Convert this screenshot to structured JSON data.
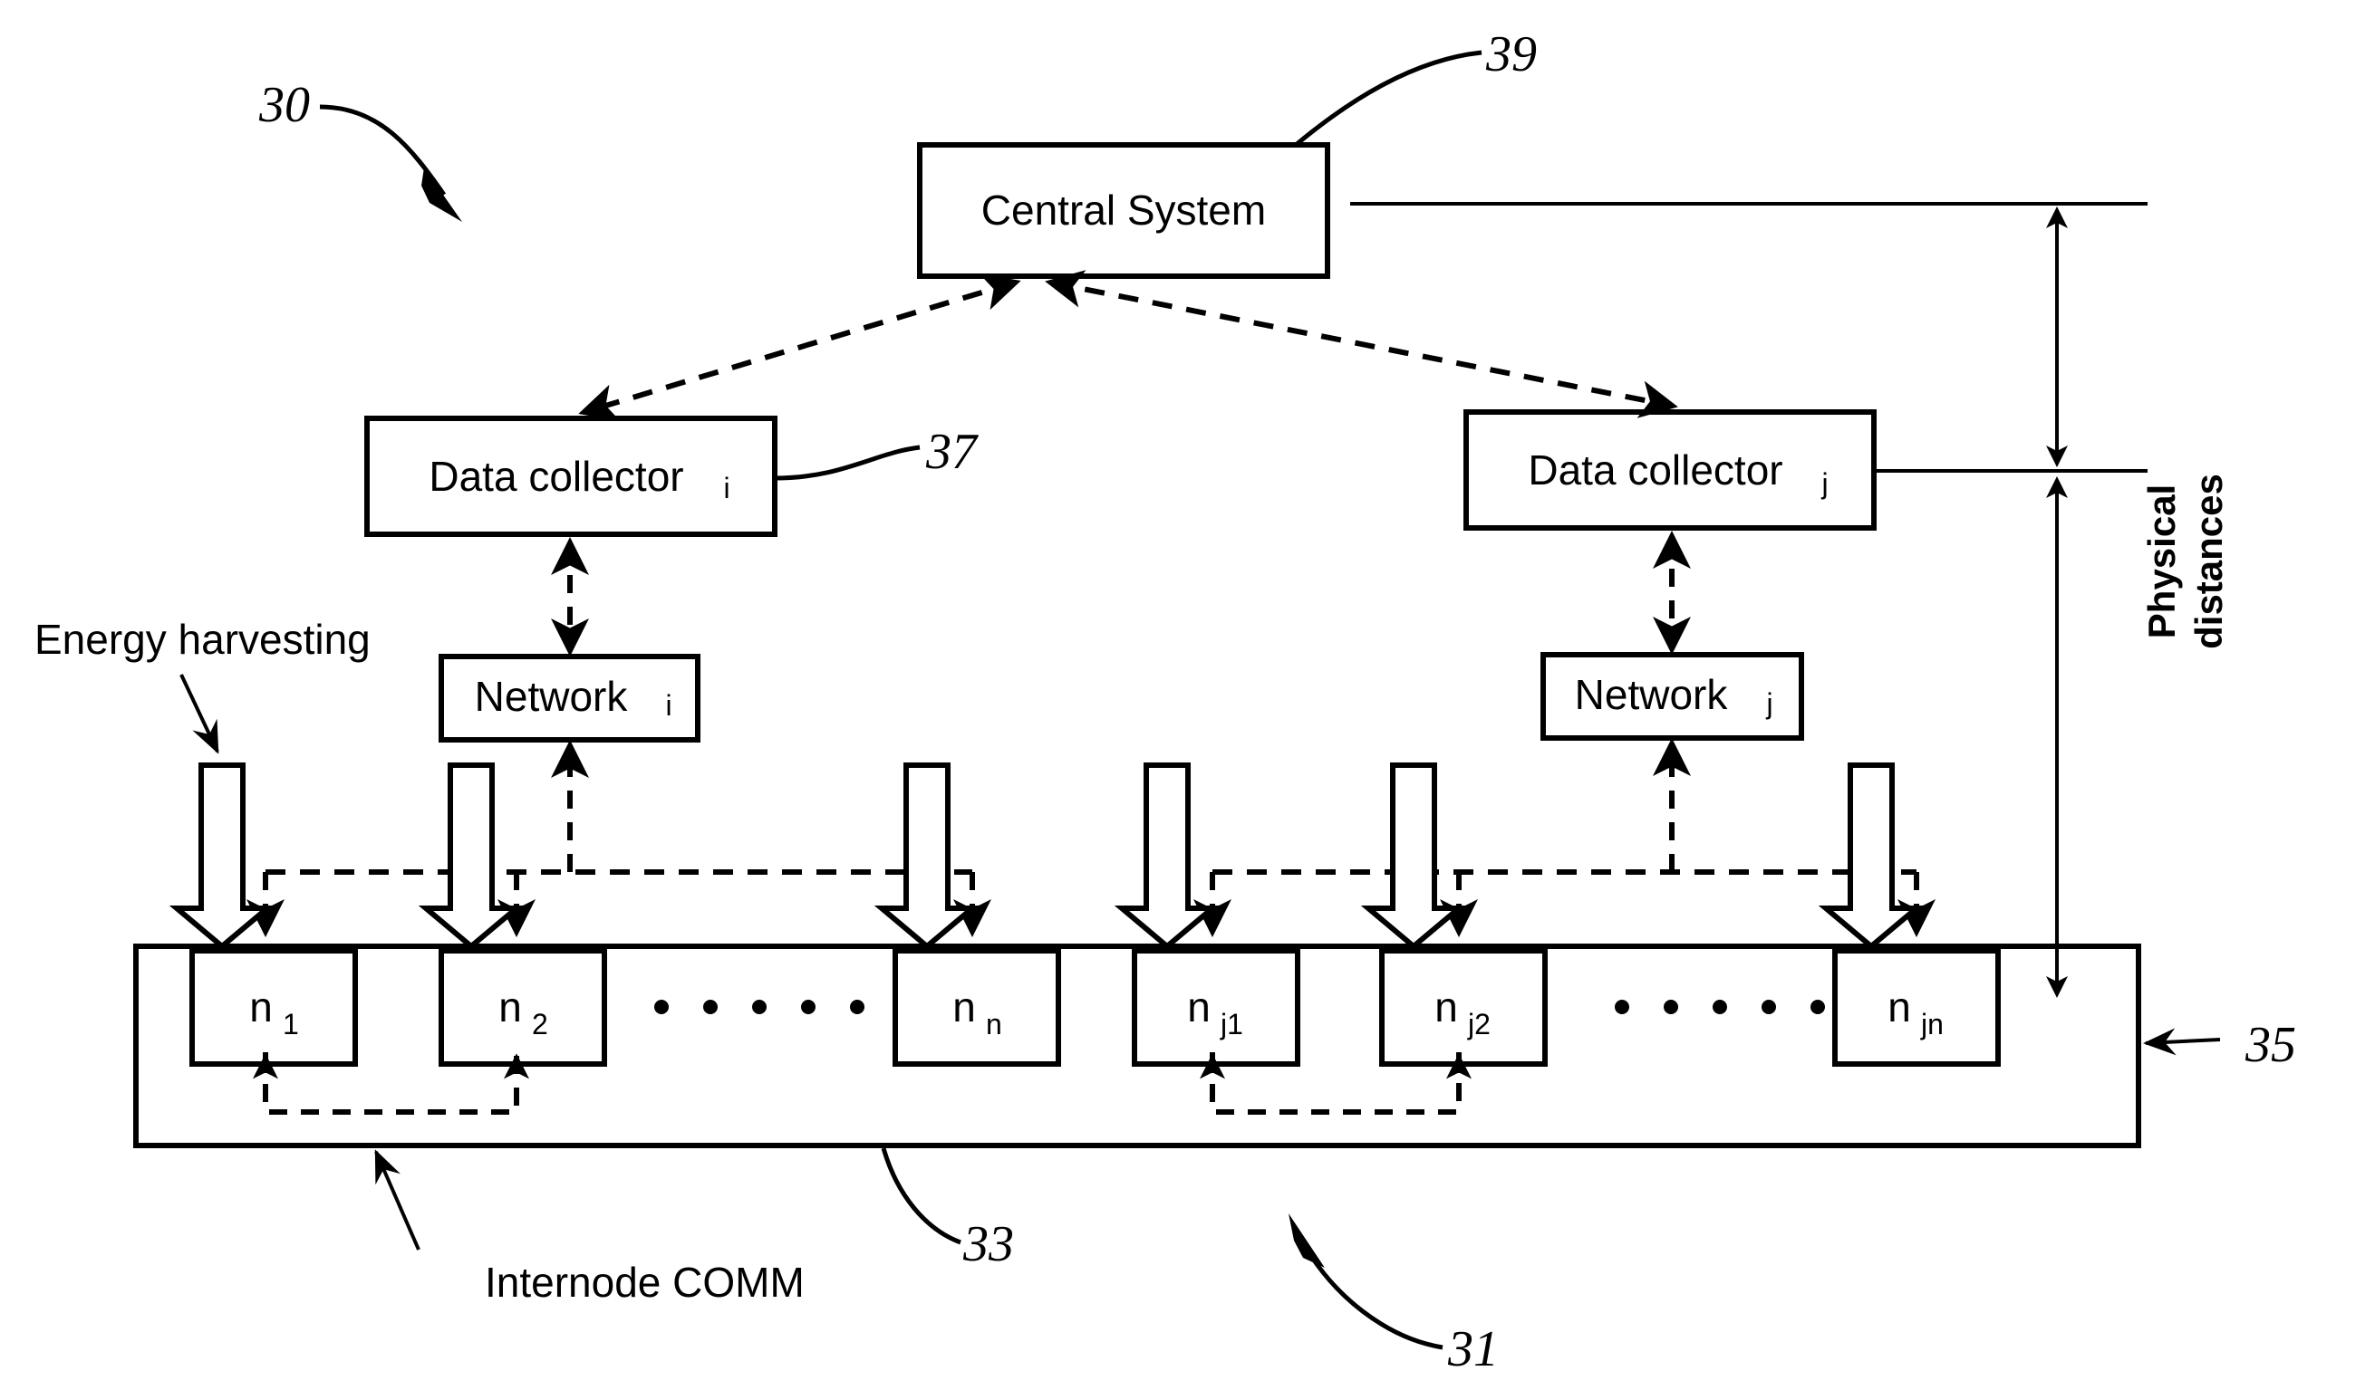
{
  "figure": {
    "title": "Sensor network architecture block diagram",
    "line_color": "#000000",
    "background": "#ffffff"
  },
  "blocks": {
    "central_system": {
      "label": "Central System",
      "ref": "39"
    },
    "data_collector_i": {
      "label": "Data collector",
      "subscript": "i",
      "ref": "37"
    },
    "data_collector_j": {
      "label": "Data collector",
      "subscript": "j"
    },
    "network_i": {
      "label": "Network",
      "subscript": "i"
    },
    "network_j": {
      "label": "Network",
      "subscript": "j"
    }
  },
  "nodes": [
    {
      "label": "n",
      "subscript": "1",
      "name": "node-n1"
    },
    {
      "label": "n",
      "subscript": "2",
      "name": "node-n2"
    },
    {
      "label": "n",
      "subscript": "n",
      "name": "node-nn"
    },
    {
      "label": "n",
      "subscript": "j1",
      "name": "node-nj1"
    },
    {
      "label": "n",
      "subscript": "j2",
      "name": "node-nj2"
    },
    {
      "label": "n",
      "subscript": "jn",
      "name": "node-njn"
    }
  ],
  "annotations": {
    "energy_harvesting": "Energy harvesting",
    "internode_comm": "Internode COMM",
    "physical_distances_line1": "Physical",
    "physical_distances_line2": "distances"
  },
  "reference_numerals": {
    "overall": "30",
    "node_layer": "31",
    "node_container": "33",
    "node_region": "35",
    "data_collector": "37",
    "central_system": "39"
  },
  "ellipses": {
    "left": "• • • • •",
    "right": "• • • • •"
  }
}
